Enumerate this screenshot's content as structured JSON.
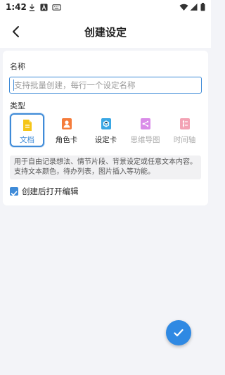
{
  "status_bar": {
    "time": "1:42",
    "icons": [
      "download-icon",
      "a-icon",
      "keyboard-icon",
      "wifi-icon",
      "signal-icon",
      "battery-icon"
    ]
  },
  "header": {
    "title": "创建设定",
    "back_icon": "chevron-left-icon"
  },
  "form": {
    "name_label": "名称",
    "name_placeholder": "支持批量创建，每行一个设定名称",
    "type_label": "类型",
    "types": [
      {
        "label": "文档",
        "icon": "document-icon",
        "color": "#f5c518",
        "selected": true,
        "enabled": true
      },
      {
        "label": "角色卡",
        "icon": "character-card-icon",
        "color": "#f57c3b",
        "selected": false,
        "enabled": true
      },
      {
        "label": "设定卡",
        "icon": "setting-card-icon",
        "color": "#3aa7e4",
        "selected": false,
        "enabled": true
      },
      {
        "label": "思维导图",
        "icon": "mind-map-icon",
        "color": "#d98ce8",
        "selected": false,
        "enabled": false
      },
      {
        "label": "时间轴",
        "icon": "timeline-icon",
        "color": "#f3a3b5",
        "selected": false,
        "enabled": false
      }
    ],
    "description": "用于自由记录想法、情节片段、背景设定或任意文本内容。支持文本颜色，待办列表，图片插入等功能。",
    "open_after_create_label": "创建后打开编辑",
    "open_after_create_checked": true
  },
  "fab": {
    "icon": "check-icon"
  },
  "colors": {
    "accent": "#3f8bd8",
    "fab": "#2f89e3",
    "background": "#f3f4f8"
  }
}
